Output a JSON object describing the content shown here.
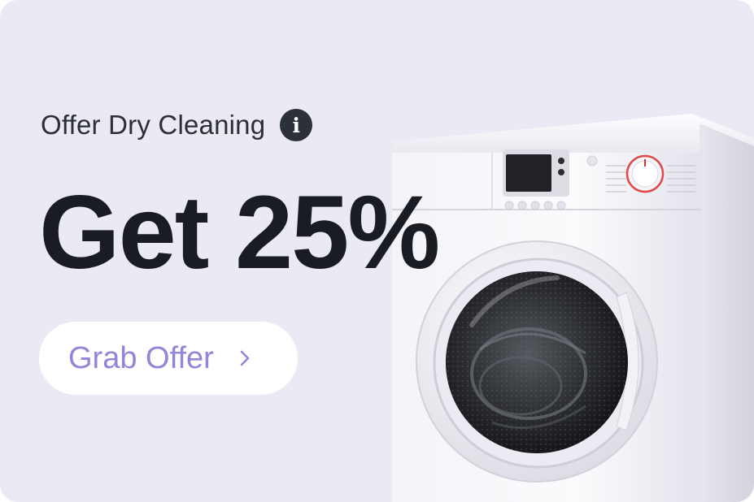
{
  "offer": {
    "subtitle": "Offer Dry Cleaning",
    "headline": "Get 25%",
    "cta_label": "Grab Offer"
  },
  "icons": {
    "info": "info-icon",
    "chevron": "chevron-right-icon",
    "product": "washing-machine-icon"
  },
  "colors": {
    "card_background": "#ebeaf4",
    "headline": "#191c22",
    "subtitle": "#2b2f38",
    "cta_text": "#9087d9",
    "cta_background": "#ffffff"
  }
}
